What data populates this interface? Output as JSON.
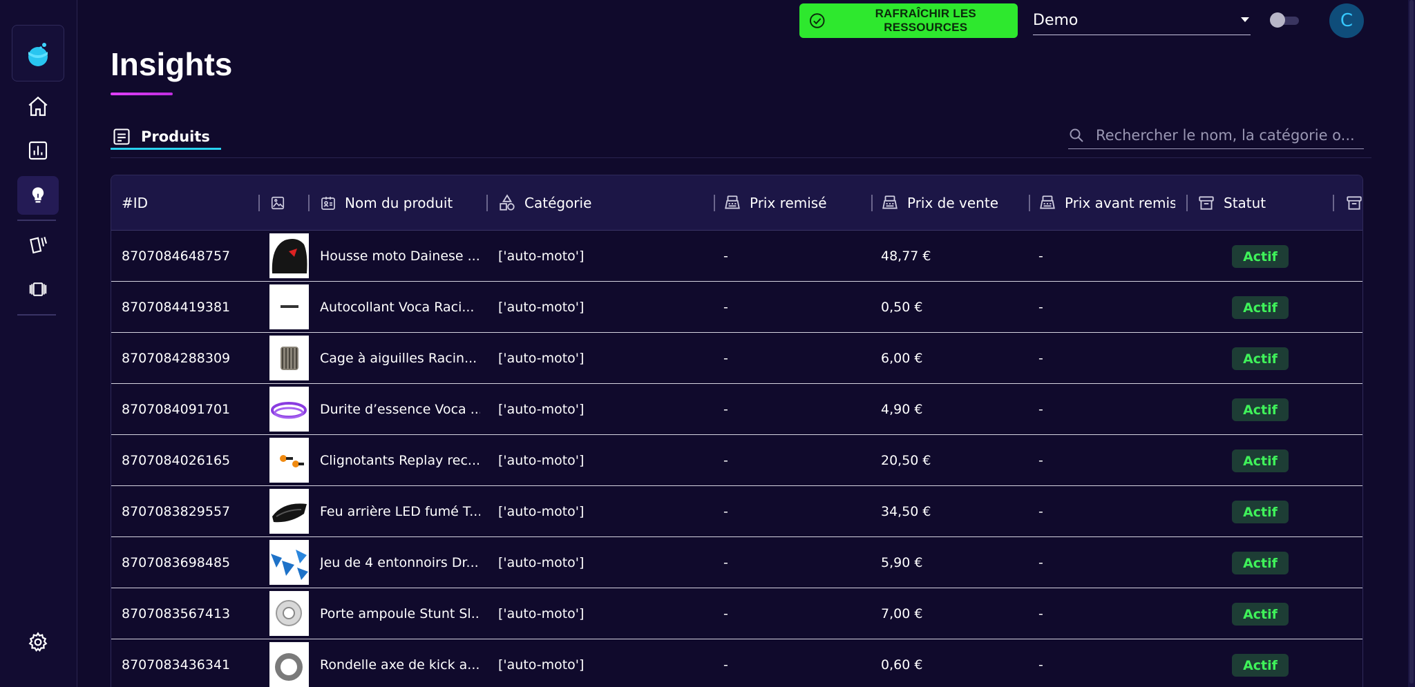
{
  "sidebar": {
    "items": [
      {
        "name": "home",
        "icon": "home-icon"
      },
      {
        "name": "analytics",
        "icon": "bar-chart-icon"
      },
      {
        "name": "insights",
        "icon": "lightbulb-icon",
        "active": true
      },
      {
        "name": "cards",
        "icon": "cards-icon"
      },
      {
        "name": "carousel",
        "icon": "carousel-icon"
      }
    ],
    "settings_icon": "gear-icon"
  },
  "topbar": {
    "refresh_label": "RAFRAÎCHIR LES RESSOURCES",
    "org_value": "Demo",
    "avatar_letter": "C"
  },
  "page": {
    "title": "Insights"
  },
  "tabs": [
    {
      "label": "Produits",
      "active": true
    }
  ],
  "search": {
    "placeholder": "Rechercher le nom, la catégorie o..."
  },
  "table": {
    "columns": {
      "id": "#ID",
      "name": "Nom du produit",
      "category": "Catégorie",
      "discounted": "Prix remisé",
      "price": "Prix de vente",
      "before_discount": "Prix avant remise",
      "status": "Statut"
    },
    "rows": [
      {
        "id": "8707084648757",
        "name": "Housse moto Dainese ...",
        "category": "['auto-moto']",
        "discounted": "-",
        "price": "48,77 €",
        "before_discount": "-",
        "status": "Actif"
      },
      {
        "id": "8707084419381",
        "name": "Autocollant Voca Raci...",
        "category": "['auto-moto']",
        "discounted": "-",
        "price": "0,50 €",
        "before_discount": "-",
        "status": "Actif"
      },
      {
        "id": "8707084288309",
        "name": "Cage à aiguilles Racin...",
        "category": "['auto-moto']",
        "discounted": "-",
        "price": "6,00 €",
        "before_discount": "-",
        "status": "Actif"
      },
      {
        "id": "8707084091701",
        "name": "Durite d’essence Voca ...",
        "category": "['auto-moto']",
        "discounted": "-",
        "price": "4,90 €",
        "before_discount": "-",
        "status": "Actif"
      },
      {
        "id": "8707084026165",
        "name": "Clignotants Replay rec...",
        "category": "['auto-moto']",
        "discounted": "-",
        "price": "20,50 €",
        "before_discount": "-",
        "status": "Actif"
      },
      {
        "id": "8707083829557",
        "name": "Feu arrière LED fumé T...",
        "category": "['auto-moto']",
        "discounted": "-",
        "price": "34,50 €",
        "before_discount": "-",
        "status": "Actif"
      },
      {
        "id": "8707083698485",
        "name": "Jeu de 4 entonnoirs Dr...",
        "category": "['auto-moto']",
        "discounted": "-",
        "price": "5,90 €",
        "before_discount": "-",
        "status": "Actif"
      },
      {
        "id": "8707083567413",
        "name": "Porte ampoule Stunt Sl...",
        "category": "['auto-moto']",
        "discounted": "-",
        "price": "7,00 €",
        "before_discount": "-",
        "status": "Actif"
      },
      {
        "id": "8707083436341",
        "name": "Rondelle axe de kick a...",
        "category": "['auto-moto']",
        "discounted": "-",
        "price": "0,60 €",
        "before_discount": "-",
        "status": "Actif"
      }
    ]
  },
  "colors": {
    "background": "#100a2c",
    "accent_green": "#2ee82e",
    "accent_cyan": "#29d3f0",
    "accent_magenta": "#e040fb",
    "status_active_text": "#3ff25a"
  }
}
